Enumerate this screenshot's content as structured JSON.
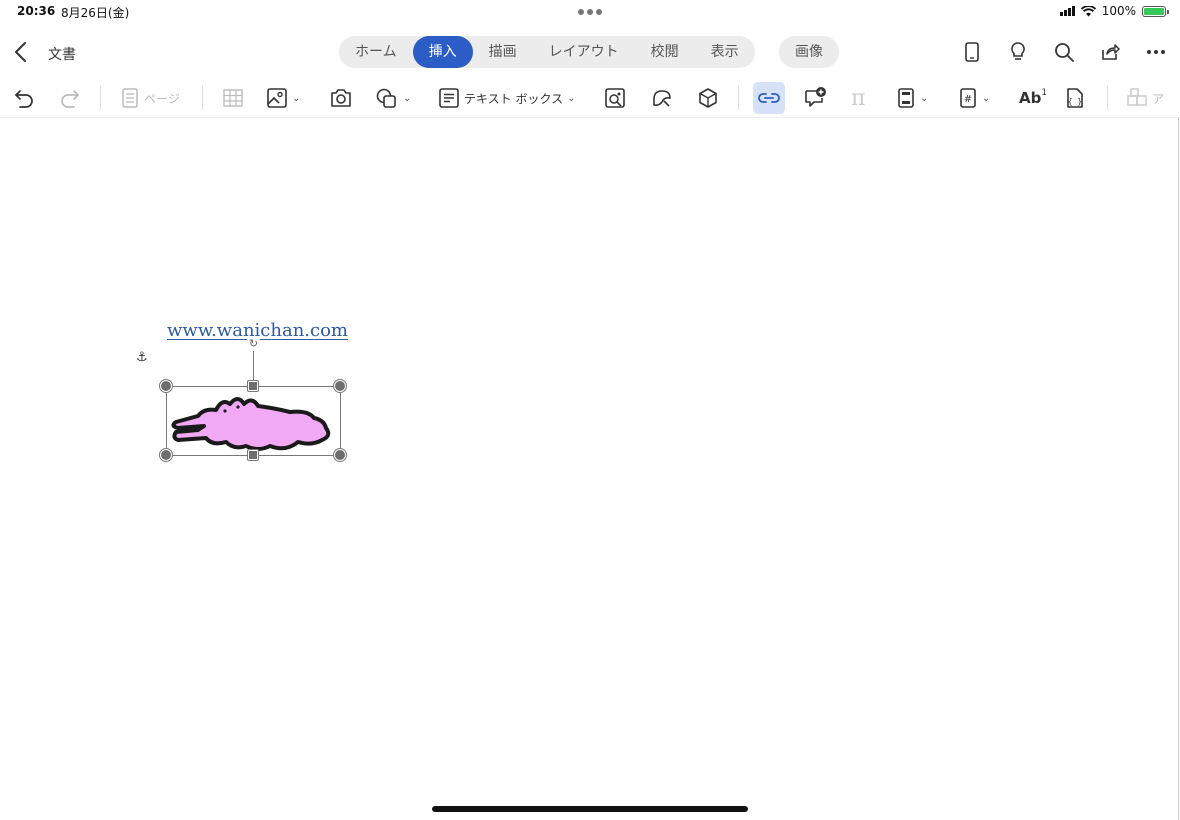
{
  "status": {
    "time": "20:36",
    "date": "8月26日(金)",
    "battery": "100%"
  },
  "header": {
    "back_label": "",
    "doc_title": "文書"
  },
  "tabs": [
    {
      "label": "ホーム"
    },
    {
      "label": "挿入",
      "active": true
    },
    {
      "label": "描画"
    },
    {
      "label": "レイアウト"
    },
    {
      "label": "校閲"
    },
    {
      "label": "表示"
    }
  ],
  "context_tab": {
    "label": "画像"
  },
  "title_icons": [
    "mobile-view-icon",
    "lightbulb-icon",
    "search-icon",
    "share-icon",
    "more-icon"
  ],
  "ribbon": {
    "page_label": "ページ",
    "textbox_label": "テキスト ボックス",
    "equation_label": "π",
    "wordart_label": "Ab",
    "truncated_label": "ア"
  },
  "document": {
    "link_text": "www.wanichan.com",
    "anchor_glyph": "⚓",
    "image": {
      "fill": "#f2a9f5",
      "outline": "#1a1a1a"
    }
  },
  "colors": {
    "accent": "#2c5cc5",
    "link": "#2a5aa8",
    "selected_bg": "#d6e2f7"
  }
}
